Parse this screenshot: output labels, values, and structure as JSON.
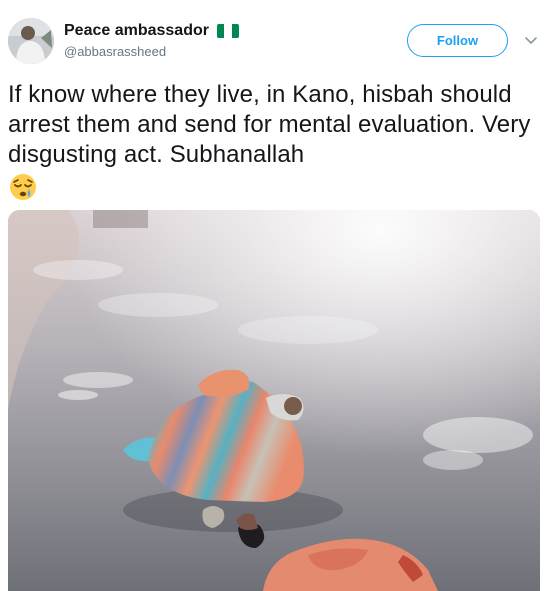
{
  "tweet": {
    "display_name": "Peace ambassador",
    "handle": "@abbasrassheed",
    "follow_label": "Follow",
    "text": "If know where they live, in Kano, hisbah should arrest them and send for mental evaluation. Very disgusting act. Subhanallah",
    "badge_icon": "nigeria-flag-icon",
    "emoji_icon": "sleepy-face-emoji",
    "menu_icon": "chevron-down-icon"
  },
  "colors": {
    "accent": "#1da1f2",
    "text": "#14171a",
    "muted": "#657786",
    "flag_green": "#008751"
  }
}
